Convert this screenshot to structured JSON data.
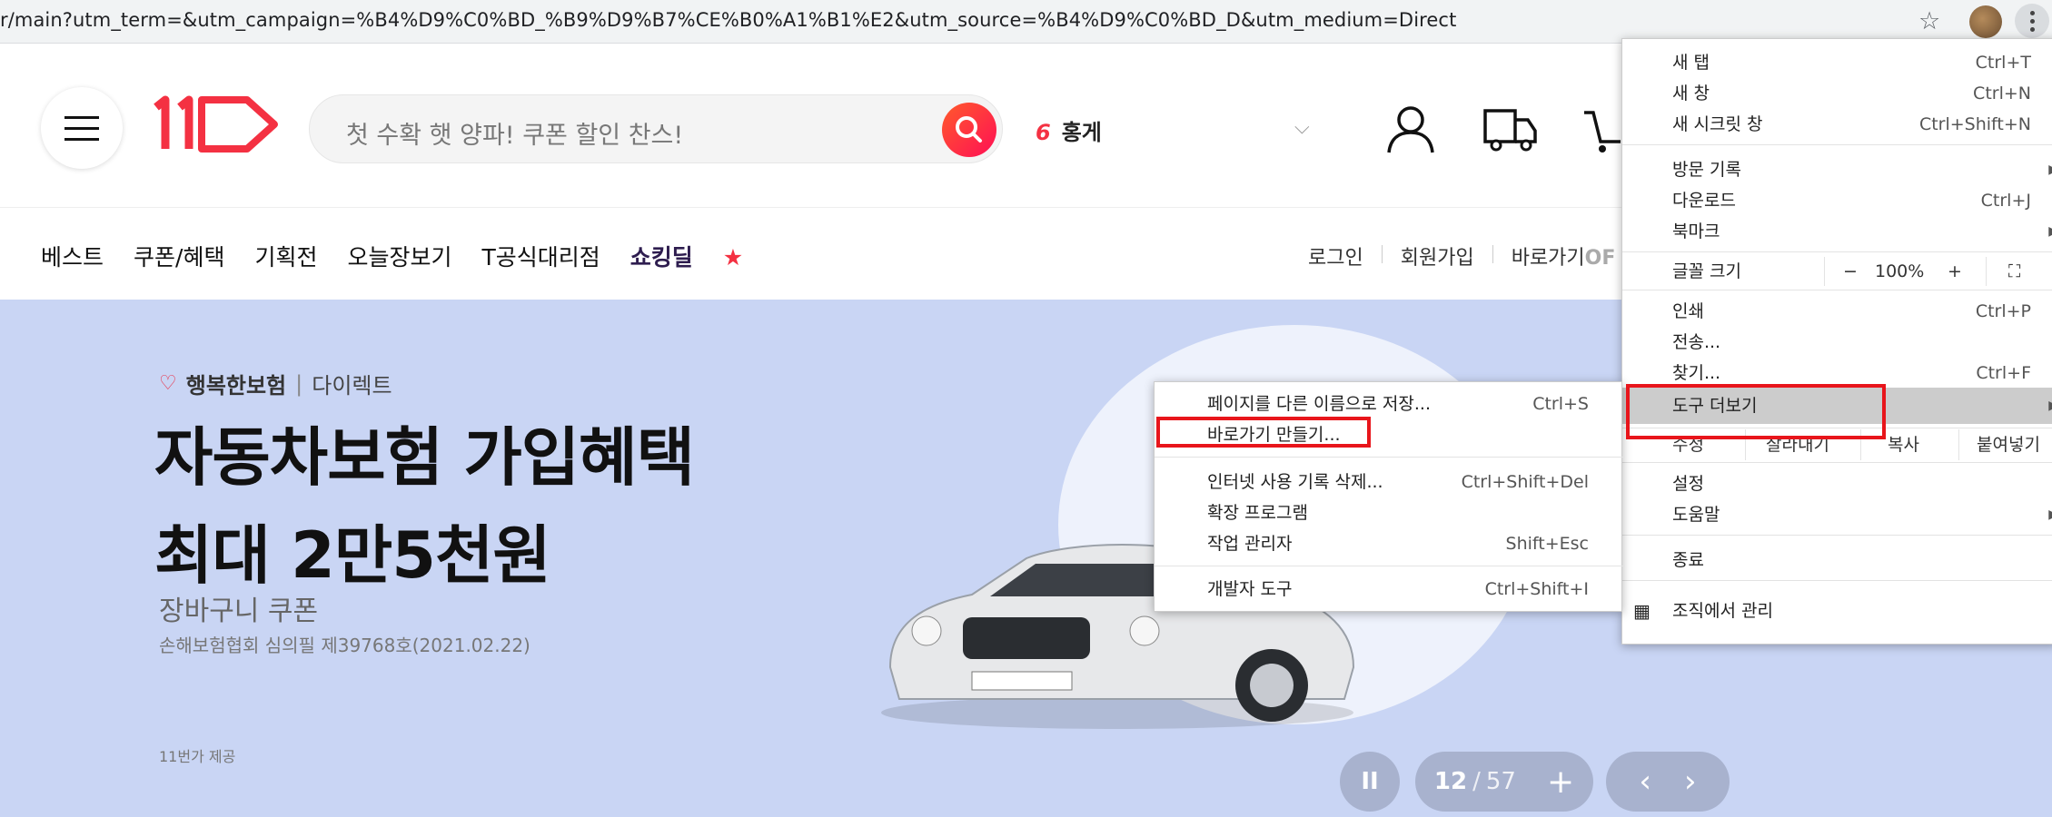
{
  "browser": {
    "url": "r/main?utm_term=&utm_campaign=%B4%D9%C0%BD_%B9%D9%B7%CE%B0%A1%B1%E2&utm_source=%B4%D9%C0%BD_D&utm_medium=Direct",
    "icons": [
      "star-icon",
      "profile-icon",
      "kebab-menu-icon"
    ]
  },
  "header": {
    "search_placeholder": "첫 수확 햇 양파! 쿠폰 할인 찬스!",
    "trend_rank": "6",
    "trend_keyword": "홍게",
    "logo_text": "11"
  },
  "nav": {
    "items": [
      "베스트",
      "쿠폰/혜택",
      "기획전",
      "오늘장보기",
      "T공식대리점"
    ],
    "brand": {
      "part1": "쇼킹딜",
      "accent": ""
    },
    "util": [
      "로그인",
      "회원가입",
      "바로가기"
    ],
    "util_suffix": "OF"
  },
  "banner": {
    "brand": "행복한보험",
    "brand_sub": "다이렉트",
    "headline_line1": "자동차보험 가입혜택",
    "headline_line2": "최대 2만5천원",
    "sub1": "장바구니 쿠폰",
    "sub2": "손해보험협회 심의필 제39768호(2021.02.22)",
    "provider": "11번가 제공",
    "page_current": "12",
    "page_total": "57",
    "plus": "+",
    "pause": "II",
    "prev": "‹",
    "next": "›"
  },
  "chrome_menu": {
    "new_tab": "새 탭",
    "new_tab_sc": "Ctrl+T",
    "new_window": "새 창",
    "new_window_sc": "Ctrl+N",
    "incognito": "새 시크릿 창",
    "incognito_sc": "Ctrl+Shift+N",
    "history": "방문 기록",
    "downloads": "다운로드",
    "downloads_sc": "Ctrl+J",
    "bookmarks": "북마크",
    "zoom_label": "글꼴 크기",
    "zoom_minus": "−",
    "zoom_value": "100%",
    "zoom_plus": "+",
    "print": "인쇄",
    "print_sc": "Ctrl+P",
    "cast": "전송...",
    "find": "찾기...",
    "find_sc": "Ctrl+F",
    "more_tools": "도구 더보기",
    "edit": "수정",
    "cut": "잘라내기",
    "copy": "복사",
    "paste": "붙여넣기",
    "settings": "설정",
    "help": "도움말",
    "exit": "종료",
    "managed": "조직에서 관리"
  },
  "submenu": {
    "save_page": "페이지를 다른 이름으로 저장...",
    "save_page_sc": "Ctrl+S",
    "create_shortcut": "바로가기 만들기...",
    "clear_data": "인터넷 사용 기록 삭제...",
    "clear_data_sc": "Ctrl+Shift+Del",
    "extensions": "확장 프로그램",
    "task_manager": "작업 관리자",
    "task_manager_sc": "Shift+Esc",
    "dev_tools": "개발자 도구",
    "dev_tools_sc": "Ctrl+Shift+I"
  }
}
